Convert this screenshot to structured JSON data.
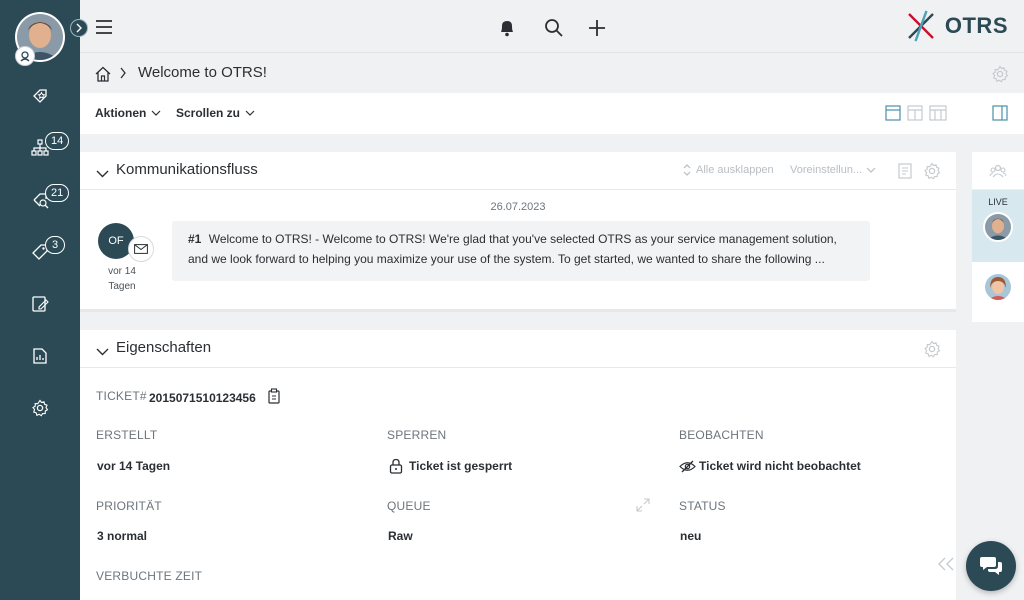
{
  "app": {
    "logo_text": "OTRS",
    "accent": "#2b4a55"
  },
  "sidebar": {
    "items": [
      {
        "icon": "star-tag-icon",
        "badge": ""
      },
      {
        "icon": "org-tree-icon",
        "badge": "14"
      },
      {
        "icon": "search-tag-icon",
        "badge": "21"
      },
      {
        "icon": "tag-icon",
        "badge": "3"
      },
      {
        "icon": "edit-note-icon",
        "badge": ""
      },
      {
        "icon": "report-icon",
        "badge": ""
      },
      {
        "icon": "gear-icon",
        "badge": ""
      }
    ]
  },
  "breadcrumb": {
    "title": "Welcome to OTRS!"
  },
  "actions": {
    "aktionen": "Aktionen",
    "scrollen": "Scrollen zu"
  },
  "communication": {
    "title": "Kommunikationsfluss",
    "expand_all": "Alle ausklappen",
    "presets": "Voreinstellun...",
    "date": "26.07.2023",
    "avatar_initials": "OF",
    "age_line1": "vor 14",
    "age_line2": "Tagen",
    "msg_number": "#1",
    "msg_text": "Welcome to OTRS!  -  Welcome to OTRS! We're glad that you've selected OTRS as your service management solution, and we look forward to helping you maximize your use of the system. To get started, we wanted to share the following ..."
  },
  "properties": {
    "title": "Eigenschaften",
    "ticket_label": "TICKET#",
    "ticket_number": "2015071510123456",
    "created_label": "ERSTELLT",
    "created_value": "vor 14 Tagen",
    "lock_label": "SPERREN",
    "lock_value": "Ticket ist gesperrt",
    "watch_label": "BEOBACHTEN",
    "watch_value": "Ticket wird nicht beobachtet",
    "priority_label": "PRIORITÄT",
    "priority_value": "3 normal",
    "queue_label": "QUEUE",
    "queue_value": "Raw",
    "status_label": "STATUS",
    "status_value": "neu",
    "time_label": "VERBUCHTE ZEIT"
  },
  "rail": {
    "live_label": "LIVE"
  }
}
